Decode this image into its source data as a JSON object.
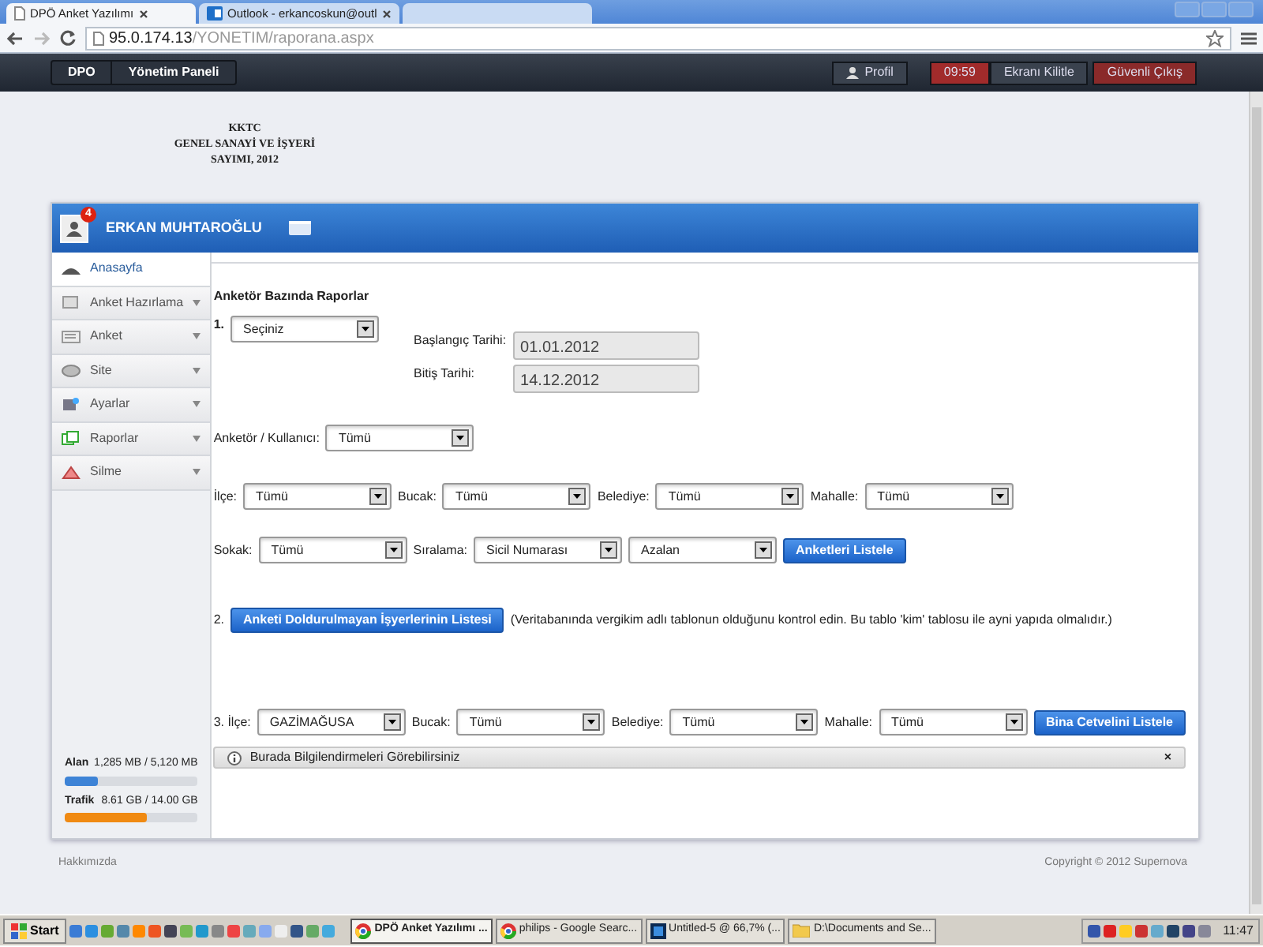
{
  "browser": {
    "tabs": [
      {
        "title": "DPÖ Anket Yazılımı",
        "selected": true
      },
      {
        "title": "Outlook - erkancoskun@outl",
        "selected": false
      }
    ],
    "url": {
      "host": "95.0.174.13",
      "path": "/YONETIM/raporana.aspx"
    }
  },
  "topnav": {
    "breadcrumb": [
      "DPO",
      "Yönetim Paneli"
    ],
    "profile": "Profil",
    "timer": "09:59",
    "lock": "Ekranı Kilitle",
    "logout": "Güvenli Çıkış"
  },
  "logo_lines": [
    "KKTC",
    "GENEL SANAYİ VE İŞYERİ",
    "SAYIMI, 2012"
  ],
  "user": {
    "name": "ERKAN MUHTAROĞLU",
    "badge": "4"
  },
  "sidebar": {
    "items": [
      {
        "label": "Anasayfa",
        "selected": true,
        "expandable": false
      },
      {
        "label": "Anket Hazırlama",
        "selected": false,
        "expandable": true
      },
      {
        "label": "Anket",
        "selected": false,
        "expandable": true
      },
      {
        "label": "Site",
        "selected": false,
        "expandable": true
      },
      {
        "label": "Ayarlar",
        "selected": false,
        "expandable": true
      },
      {
        "label": "Raporlar",
        "selected": false,
        "expandable": true
      },
      {
        "label": "Silme",
        "selected": false,
        "expandable": true
      }
    ]
  },
  "usage": [
    {
      "label": "Alan",
      "reading": "1,285 MB / 5,120 MB",
      "level": 0.25,
      "color": "#3d83d6"
    },
    {
      "label": "Trafik",
      "reading": "8.61 GB / 14.00 GB",
      "level": 0.615,
      "color": "#f08a12"
    }
  ],
  "content": {
    "heading": "Anketör Bazında Raporlar",
    "rows": [
      {
        "items": [
          {
            "kind": "number",
            "text": "1."
          },
          {
            "kind": "select",
            "value": "Seçiniz"
          },
          {
            "kind": "dates",
            "fields": [
              {
                "label": "Başlangıç Tarihi:",
                "value": "01.01.2012"
              },
              {
                "label": "Bitiş Tarihi:",
                "value": "14.12.2012"
              }
            ]
          }
        ]
      },
      {
        "items": [
          {
            "kind": "label",
            "text": "Anketör / Kullanıcı:"
          },
          {
            "kind": "select",
            "value": "Tümü"
          }
        ]
      },
      {
        "items": [
          {
            "kind": "label",
            "text": "İlçe:"
          },
          {
            "kind": "select",
            "value": "Tümü"
          },
          {
            "kind": "label",
            "text": "Bucak:"
          },
          {
            "kind": "select",
            "value": "Tümü"
          },
          {
            "kind": "label",
            "text": "Belediye:"
          },
          {
            "kind": "select",
            "value": "Tümü"
          },
          {
            "kind": "label",
            "text": "Mahalle:"
          },
          {
            "kind": "select",
            "value": "Tümü"
          }
        ]
      },
      {
        "items": [
          {
            "kind": "label",
            "text": "Sokak:"
          },
          {
            "kind": "select",
            "value": "Tümü"
          },
          {
            "kind": "label",
            "text": "Sıralama:"
          },
          {
            "kind": "select",
            "value": "Sicil Numarası"
          },
          {
            "kind": "select",
            "value": "Azalan"
          },
          {
            "kind": "button",
            "text": "Anketleri Listele"
          }
        ]
      },
      {
        "items": [
          {
            "kind": "label",
            "text": "2."
          },
          {
            "kind": "button",
            "text": "Anketi Doldurulmayan İşyerlerinin Listesi"
          },
          {
            "kind": "label",
            "text": "(Veritabanında vergikim adlı tablonun olduğunu kontrol edin. Bu tablo 'kim' tablosu ile ayni yapıda olmalıdır.)"
          }
        ]
      },
      {
        "items": [
          {
            "kind": "label",
            "text": "3. İlçe:"
          },
          {
            "kind": "select",
            "value": "GAZİMAĞUSA"
          },
          {
            "kind": "label",
            "text": "Bucak:"
          },
          {
            "kind": "select",
            "value": "Tümü"
          },
          {
            "kind": "label",
            "text": "Belediye:"
          },
          {
            "kind": "select",
            "value": "Tümü"
          },
          {
            "kind": "label",
            "text": "Mahalle:"
          },
          {
            "kind": "select",
            "value": "Tümü"
          },
          {
            "kind": "button",
            "text": "Bina Cetvelini Listele"
          }
        ]
      }
    ],
    "info_bar": {
      "text": "Burada Bilgilendirmeleri Görebilirsiniz",
      "close": "×"
    }
  },
  "footer": {
    "left": "Hakkımızda",
    "right": "Copyright © 2012 Supernova"
  },
  "taskbar": {
    "start": "Start",
    "tasks": [
      {
        "title": "DPÖ Anket Yazılımı ...",
        "selected": true
      },
      {
        "title": "philips - Google Searc...",
        "selected": false
      },
      {
        "title": "Untitled-5 @ 66,7% (...",
        "selected": false
      },
      {
        "title": "D:\\Documents and Se...",
        "selected": false
      }
    ],
    "clock": "11:47"
  }
}
